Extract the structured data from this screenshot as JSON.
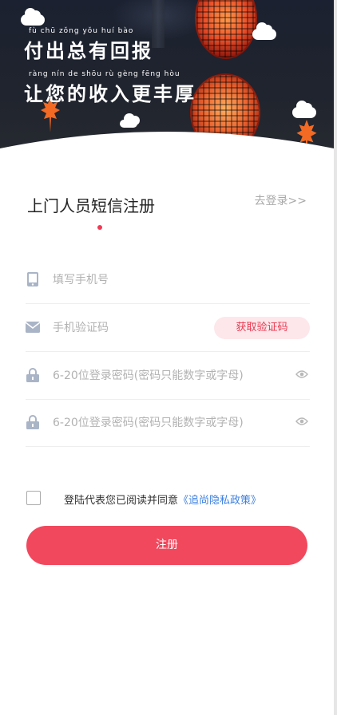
{
  "banner": {
    "pinyin_line1": "fù  chū  zǒng  yǒu  huí  bào",
    "slogan_line1": "付出总有回报",
    "pinyin_line2": "ràng  nín  de  shōu  rù  gèng  fēng  hòu",
    "slogan_line2": "让您的收入更丰厚"
  },
  "header": {
    "title": "上门人员短信注册",
    "login_link": "去登录>>"
  },
  "form": {
    "phone_placeholder": "填写手机号",
    "code_placeholder": "手机验证码",
    "get_code_label": "获取验证码",
    "password_placeholder": "6-20位登录密码(密码只能数字或字母)",
    "confirm_password_placeholder": "6-20位登录密码(密码只能数字或字母)"
  },
  "agreement": {
    "text": "登陆代表您已阅读并同意",
    "link": "《追尚隐私政策》",
    "checked": false
  },
  "submit": {
    "label": "注册"
  },
  "colors": {
    "accent": "#f1485d",
    "link": "#3a7fe0",
    "icon": "#a9b4c6"
  }
}
